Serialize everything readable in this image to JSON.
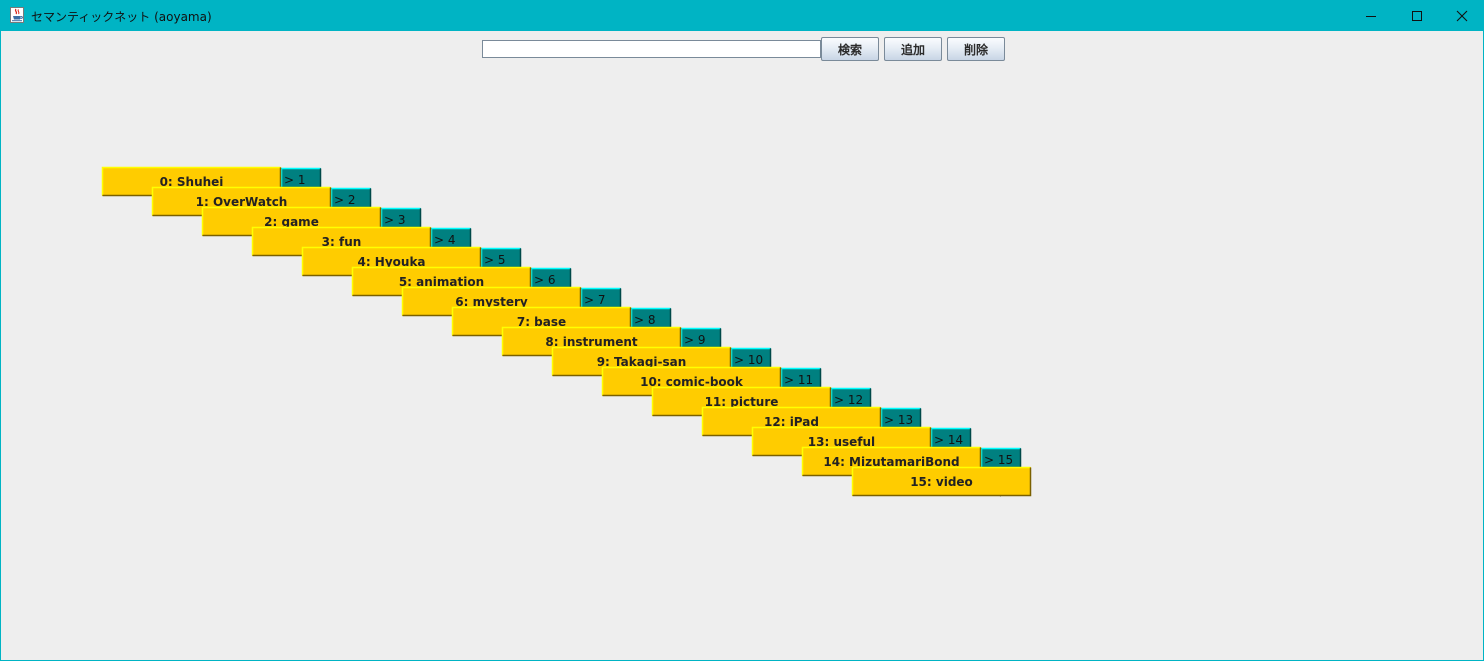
{
  "window": {
    "title": "セマンティックネット (aoyama)",
    "icon": "java-cup-icon",
    "controls": [
      "minimize-icon",
      "maximize-icon",
      "close-icon"
    ],
    "accent_color": "#00b4c4"
  },
  "toolbar": {
    "search_value": "",
    "search_label": "検索",
    "add_label": "追加",
    "delete_label": "削除"
  },
  "colors": {
    "node_fill": "#ffcc00",
    "node_highlight": "#ffff00",
    "edge_box_fill": "#008080",
    "edge_box_highlight": "#00ffff",
    "background": "#eeeeee"
  },
  "graph": {
    "nodes": [
      {
        "id": 0,
        "label": "0: Shuhei"
      },
      {
        "id": 1,
        "label": "1: OverWatch"
      },
      {
        "id": 2,
        "label": "2: game"
      },
      {
        "id": 3,
        "label": "3: fun"
      },
      {
        "id": 4,
        "label": "4: Hyouka"
      },
      {
        "id": 5,
        "label": "5: animation"
      },
      {
        "id": 6,
        "label": "6: mystery"
      },
      {
        "id": 7,
        "label": "7: base"
      },
      {
        "id": 8,
        "label": "8: instrument"
      },
      {
        "id": 9,
        "label": "9: Takagi-san"
      },
      {
        "id": 10,
        "label": "10: comic-book"
      },
      {
        "id": 11,
        "label": "11: picture"
      },
      {
        "id": 12,
        "label": "12: iPad"
      },
      {
        "id": 13,
        "label": "13: useful"
      },
      {
        "id": 14,
        "label": "14: MizutamariBond"
      },
      {
        "id": 15,
        "label": "15: video"
      }
    ],
    "edges": [
      {
        "from": 0,
        "to": 1,
        "label": "> 1"
      },
      {
        "from": 1,
        "to": 2,
        "label": "> 2"
      },
      {
        "from": 2,
        "to": 3,
        "label": "> 3"
      },
      {
        "from": 3,
        "to": 4,
        "label": "> 4"
      },
      {
        "from": 4,
        "to": 5,
        "label": "> 5"
      },
      {
        "from": 5,
        "to": 6,
        "label": "> 6"
      },
      {
        "from": 6,
        "to": 7,
        "label": "> 7"
      },
      {
        "from": 7,
        "to": 8,
        "label": "> 8"
      },
      {
        "from": 8,
        "to": 9,
        "label": "> 9"
      },
      {
        "from": 9,
        "to": 10,
        "label": "> 10"
      },
      {
        "from": 10,
        "to": 11,
        "label": "> 11"
      },
      {
        "from": 11,
        "to": 12,
        "label": "> 12"
      },
      {
        "from": 12,
        "to": 13,
        "label": "> 13"
      },
      {
        "from": 13,
        "to": 14,
        "label": "> 14"
      },
      {
        "from": 14,
        "to": 15,
        "label": "> 15"
      }
    ]
  }
}
